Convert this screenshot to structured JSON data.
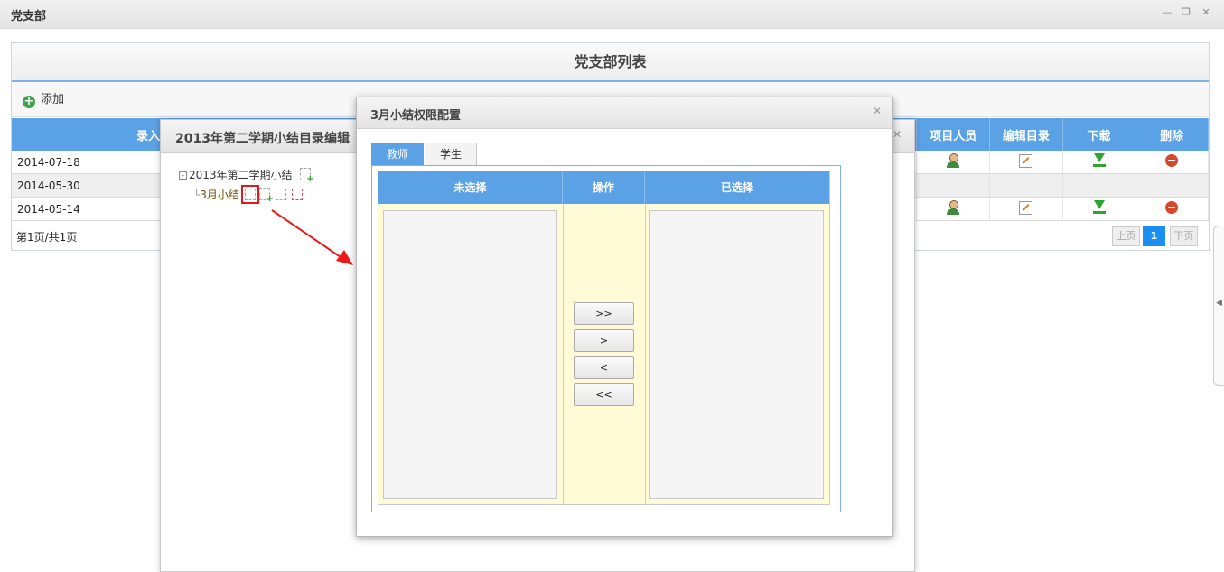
{
  "window": {
    "title": "党支部",
    "controls": [
      "minimize-icon",
      "restore-icon",
      "close-icon"
    ]
  },
  "panel": {
    "title": "党支部列表",
    "add_label": "添加",
    "columns": {
      "entry": "录入",
      "members": "项目人员",
      "edit_dir": "编辑目录",
      "download": "下载",
      "delete": "删除"
    },
    "rows": [
      {
        "date": "2014-07-18",
        "has_actions": true
      },
      {
        "date": "2014-05-30",
        "has_actions": false
      },
      {
        "date": "2014-05-14",
        "has_actions": true
      }
    ],
    "pager": {
      "info": "第1页/共1页",
      "prev": "上页",
      "current": "1",
      "next": "下页"
    }
  },
  "back_dialog": {
    "title": "2013年第二学期小结目录编辑",
    "tree": {
      "root": "2013年第二学期小结",
      "child": "3月小结"
    }
  },
  "dialog": {
    "title": "3月小结权限配置",
    "tabs": [
      "教师",
      "学生"
    ],
    "active_tab": 0,
    "columns": {
      "unselected": "未选择",
      "operation": "操作",
      "selected": "已选择"
    },
    "buttons": {
      "add_all": ">>",
      "add_one": ">",
      "remove_one": "<",
      "remove_all": "<<"
    }
  },
  "colors": {
    "accent": "#5ba1e6",
    "highlight": "#e01b1b",
    "panel_bg": "#fffbd6"
  }
}
